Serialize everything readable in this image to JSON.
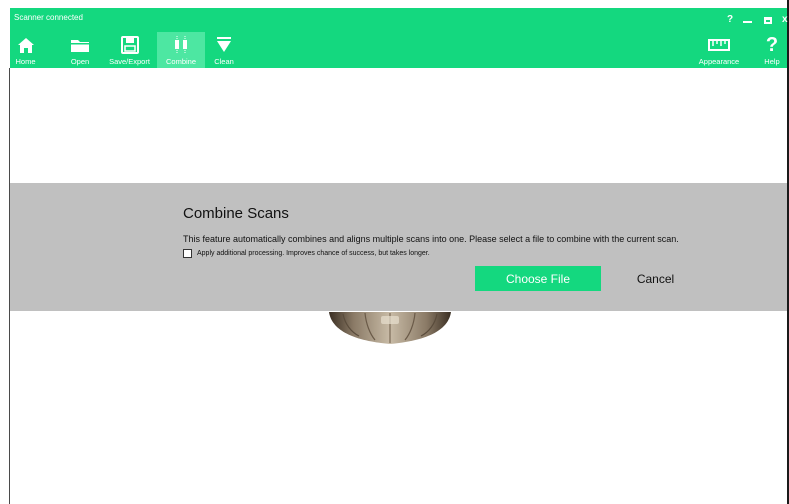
{
  "window": {
    "status": "Scanner connected",
    "controls": {
      "help": "?",
      "close": "x"
    }
  },
  "toolbar": {
    "items": [
      {
        "label": "Home",
        "icon": "home-icon"
      },
      {
        "label": "Open",
        "icon": "folder-icon"
      },
      {
        "label": "Save/Export",
        "icon": "save-icon"
      },
      {
        "label": "Combine",
        "icon": "combine-icon",
        "active": true
      },
      {
        "label": "Clean",
        "icon": "filter-icon"
      }
    ],
    "right_items": [
      {
        "label": "Appearance",
        "icon": "ruler-icon"
      },
      {
        "label": "Help",
        "icon": "help-icon",
        "glyph": "?"
      }
    ]
  },
  "dialog": {
    "title": "Combine Scans",
    "description": "This feature automatically combines and aligns multiple scans into one. Please select a file to combine with the current scan.",
    "checkbox_label": "Apply additional processing. Improves chance of success, but takes longer.",
    "checkbox_checked": false,
    "choose_file_label": "Choose File",
    "cancel_label": "Cancel"
  },
  "colors": {
    "accent": "#14d87f",
    "accent_active": "#4de7a2",
    "overlay": "#c0c0c0"
  }
}
